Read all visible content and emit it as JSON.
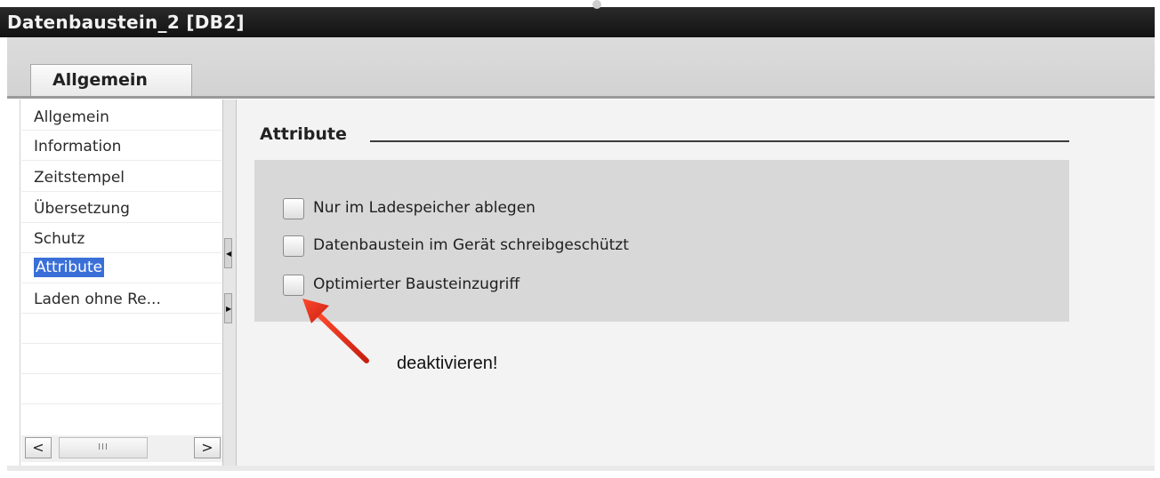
{
  "window": {
    "title": "Datenbaustein_2 [DB2]"
  },
  "tabs": [
    {
      "label": "Allgemein",
      "selected": true
    }
  ],
  "sidebar": {
    "items": [
      {
        "label": "Allgemein"
      },
      {
        "label": "Information"
      },
      {
        "label": "Zeitstempel"
      },
      {
        "label": "Übersetzung"
      },
      {
        "label": "Schutz"
      },
      {
        "label": "Attribute",
        "selected": true
      },
      {
        "label": "Laden ohne Re..."
      }
    ],
    "hscroll": {
      "left_icon": "chevron-left-icon",
      "right_icon": "chevron-right-icon",
      "left_glyph": "<",
      "right_glyph": ">",
      "thumb_glyph": "III"
    },
    "splitter": {
      "up_icon": "triangle-left-icon",
      "down_icon": "triangle-right-icon"
    }
  },
  "main": {
    "section_title": "Attribute",
    "checkboxes": [
      {
        "label": "Nur im Ladespeicher ablegen",
        "checked": false
      },
      {
        "label": "Datenbaustein im Gerät schreibgeschützt",
        "checked": false
      },
      {
        "label": "Optimierter Bausteinzugriff",
        "checked": false
      }
    ]
  },
  "annotation": {
    "text": "deaktivieren!",
    "arrow_color": "#e8311c"
  },
  "colors": {
    "titlebar": "#1a1a1a",
    "selection": "#3a6fd8",
    "group_box": "#d8d8d8"
  }
}
